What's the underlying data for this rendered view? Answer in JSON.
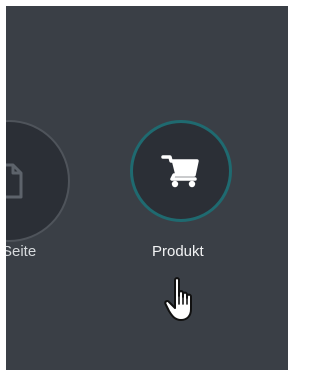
{
  "options": [
    {
      "label": "Seite",
      "icon": "page-icon"
    },
    {
      "label": "Produkt",
      "icon": "cart-icon"
    }
  ],
  "cursor": {
    "icon": "hand-pointer-icon"
  },
  "colors": {
    "background": "#3a3f46",
    "circle_fill": "#2b2f36",
    "active_border": "#1f6a70",
    "inactive_border": "#4f545b",
    "text": "#f2f3f4"
  }
}
